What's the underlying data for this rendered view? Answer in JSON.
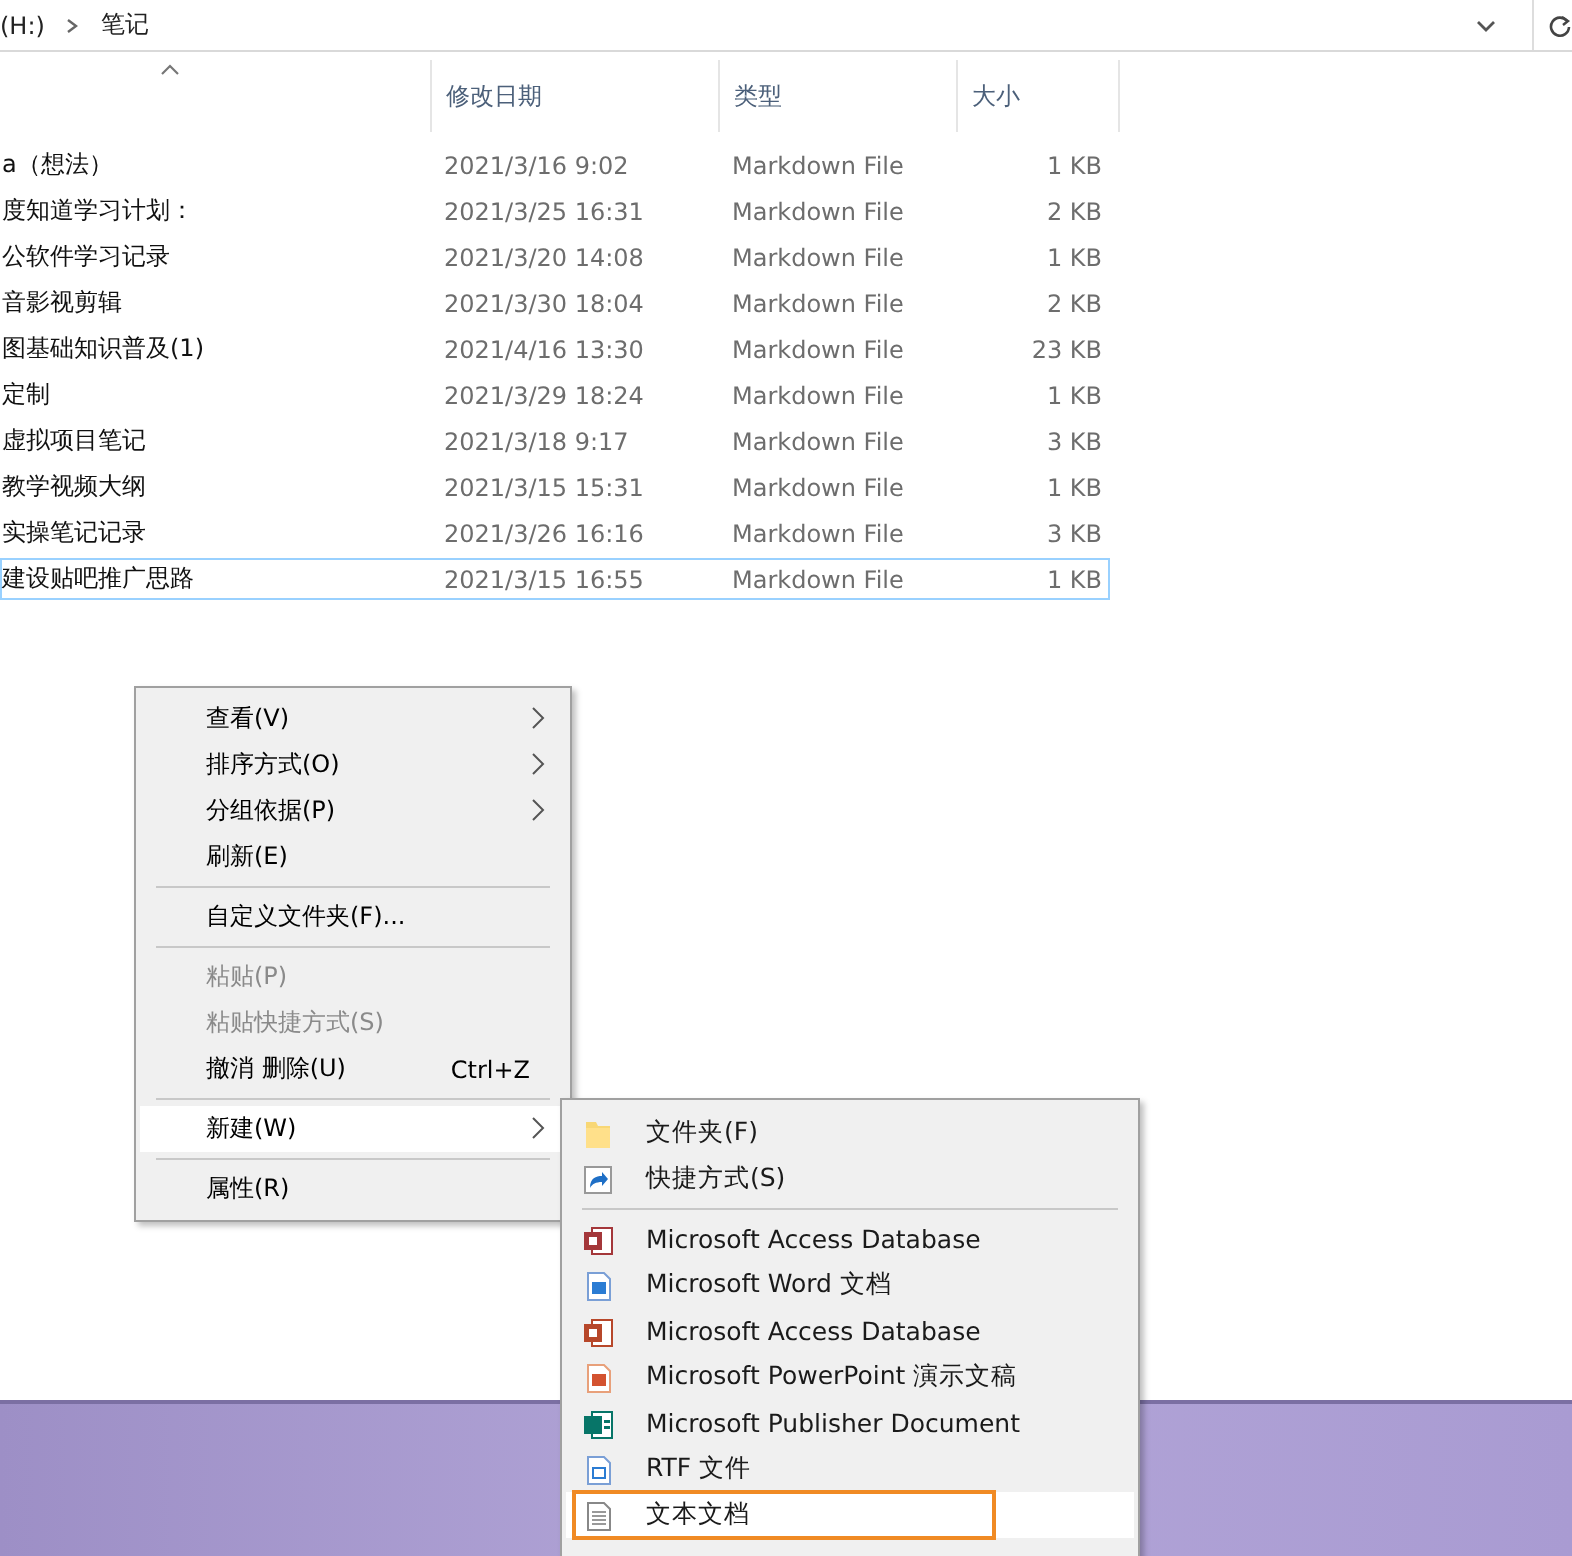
{
  "address_bar": {
    "crumbs": [
      "(H:)",
      "笔记"
    ]
  },
  "file_list": {
    "sorted": true,
    "columns": [
      "修改日期",
      "类型",
      "大小"
    ],
    "rows": [
      {
        "name": "a（想法）",
        "modified": "2021/3/16 9:02",
        "type": "Markdown File",
        "size": "1 KB",
        "selected": false
      },
      {
        "name": "度知道学习计划：",
        "modified": "2021/3/25 16:31",
        "type": "Markdown File",
        "size": "2 KB",
        "selected": false
      },
      {
        "name": "公软件学习记录",
        "modified": "2021/3/20 14:08",
        "type": "Markdown File",
        "size": "1 KB",
        "selected": false
      },
      {
        "name": "音影视剪辑",
        "modified": "2021/3/30 18:04",
        "type": "Markdown File",
        "size": "2 KB",
        "selected": false
      },
      {
        "name": "图基础知识普及(1)",
        "modified": "2021/4/16 13:30",
        "type": "Markdown File",
        "size": "23 KB",
        "selected": false
      },
      {
        "name": "定制",
        "modified": "2021/3/29 18:24",
        "type": "Markdown File",
        "size": "1 KB",
        "selected": false
      },
      {
        "name": "虚拟项目笔记",
        "modified": "2021/3/18 9:17",
        "type": "Markdown File",
        "size": "3 KB",
        "selected": false
      },
      {
        "name": "教学视频大纲",
        "modified": "2021/3/15 15:31",
        "type": "Markdown File",
        "size": "1 KB",
        "selected": false
      },
      {
        "name": "实操笔记记录",
        "modified": "2021/3/26 16:16",
        "type": "Markdown File",
        "size": "3 KB",
        "selected": false
      },
      {
        "name": "建设贴吧推广思路",
        "modified": "2021/3/15 16:55",
        "type": "Markdown File",
        "size": "1 KB",
        "selected": true
      }
    ]
  },
  "context_menu": {
    "items": [
      {
        "kind": "item",
        "label": "查看(V)",
        "submenu": true,
        "disabled": false,
        "selected": false
      },
      {
        "kind": "item",
        "label": "排序方式(O)",
        "submenu": true,
        "disabled": false,
        "selected": false
      },
      {
        "kind": "item",
        "label": "分组依据(P)",
        "submenu": true,
        "disabled": false,
        "selected": false
      },
      {
        "kind": "item",
        "label": "刷新(E)",
        "submenu": false,
        "disabled": false,
        "selected": false
      },
      {
        "kind": "separator"
      },
      {
        "kind": "item",
        "label": "自定义文件夹(F)...",
        "submenu": false,
        "disabled": false,
        "selected": false
      },
      {
        "kind": "separator"
      },
      {
        "kind": "item",
        "label": "粘贴(P)",
        "submenu": false,
        "disabled": true,
        "selected": false
      },
      {
        "kind": "item",
        "label": "粘贴快捷方式(S)",
        "submenu": false,
        "disabled": true,
        "selected": false
      },
      {
        "kind": "item",
        "label": "撤消 删除(U)",
        "shortcut": "Ctrl+Z",
        "submenu": false,
        "disabled": false,
        "selected": false
      },
      {
        "kind": "separator"
      },
      {
        "kind": "item",
        "label": "新建(W)",
        "submenu": true,
        "disabled": false,
        "selected": true
      },
      {
        "kind": "separator"
      },
      {
        "kind": "item",
        "label": "属性(R)",
        "submenu": false,
        "disabled": false,
        "selected": false
      }
    ]
  },
  "new_submenu": {
    "items": [
      {
        "kind": "folder",
        "label": "文件夹(F)",
        "selected": false,
        "annotated": false
      },
      {
        "kind": "shortcut",
        "label": "快捷方式(S)",
        "selected": false,
        "annotated": false
      },
      {
        "kind": "separator"
      },
      {
        "kind": "access",
        "label": "Microsoft Access Database",
        "selected": false,
        "annotated": false
      },
      {
        "kind": "word",
        "label": "Microsoft Word 文档",
        "selected": false,
        "annotated": false
      },
      {
        "kind": "presentation",
        "label": "Microsoft Access Database",
        "selected": false,
        "annotated": false
      },
      {
        "kind": "powerpoint",
        "label": "Microsoft PowerPoint 演示文稿",
        "selected": false,
        "annotated": false
      },
      {
        "kind": "publisher",
        "label": "Microsoft Publisher Document",
        "selected": false,
        "annotated": false
      },
      {
        "kind": "rtf",
        "label": "RTF 文件",
        "selected": false,
        "annotated": false
      },
      {
        "kind": "text",
        "label": "文本文档",
        "selected": true,
        "annotated": true
      }
    ]
  }
}
